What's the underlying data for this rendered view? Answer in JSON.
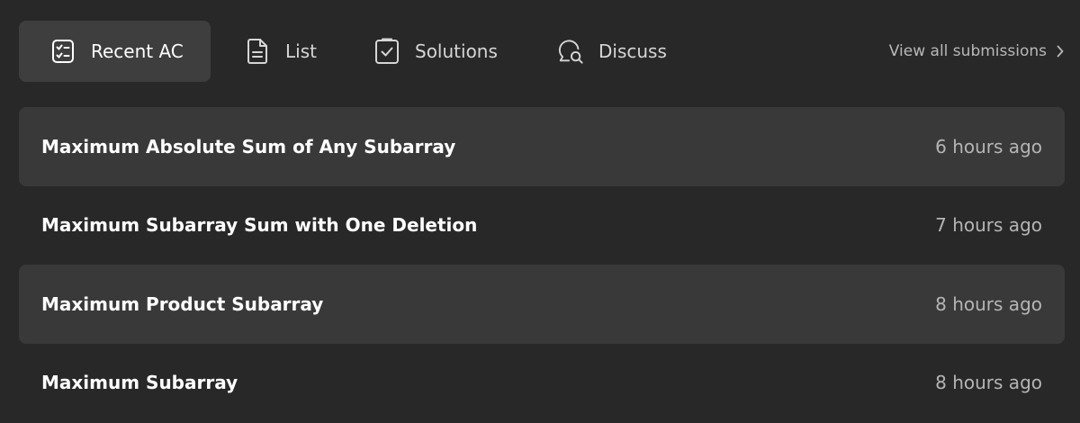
{
  "tabs": [
    {
      "label": "Recent AC",
      "icon": "checklist-icon",
      "active": true
    },
    {
      "label": "List",
      "icon": "document-icon",
      "active": false
    },
    {
      "label": "Solutions",
      "icon": "checkbox-icon",
      "active": false
    },
    {
      "label": "Discuss",
      "icon": "chat-search-icon",
      "active": false
    }
  ],
  "view_all": {
    "label": "View all submissions",
    "icon": "chevron-right-icon"
  },
  "submissions": [
    {
      "title": "Maximum Absolute Sum of Any Subarray",
      "time": "6 hours ago"
    },
    {
      "title": "Maximum Subarray Sum with One Deletion",
      "time": "7 hours ago"
    },
    {
      "title": "Maximum Product Subarray",
      "time": "8 hours ago"
    },
    {
      "title": "Maximum Subarray",
      "time": "8 hours ago"
    }
  ],
  "colors": {
    "background": "#282828",
    "active_tab": "#3e3e3e",
    "row_shaded": "#393939",
    "text_primary": "#ffffff",
    "text_secondary": "#b5b5b5"
  }
}
